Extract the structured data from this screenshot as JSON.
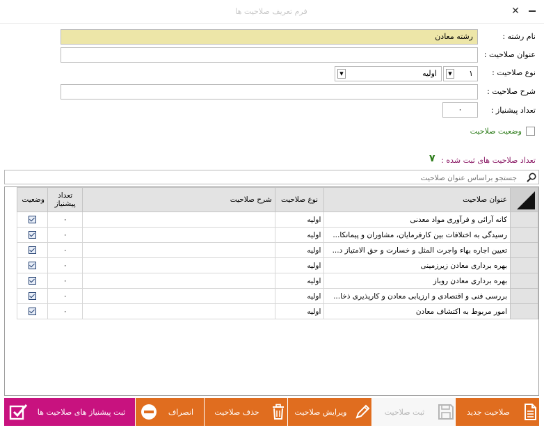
{
  "window": {
    "title": "فرم تعریف صلاحیت ها",
    "close_glyph": "✕",
    "minimize_label": "minimize"
  },
  "form": {
    "field_label": "نام رشته :",
    "field_value": "رشته معادن",
    "title_label": "عنوان صلاحیت :",
    "title_value": "",
    "type_label": "نوع صلاحیت :",
    "type_code": "۱",
    "type_value": "اولیه",
    "desc_label": "شرح صلاحیت :",
    "desc_value": "",
    "prereq_label": "تعداد پیشنیاز :",
    "prereq_value": "۰",
    "status_label": "وضعیت صلاحیت"
  },
  "count": {
    "label": "تعداد صلاحیت های ثبت شده :",
    "value": "۷"
  },
  "search": {
    "placeholder": "جستجو براساس عنوان صلاحیت"
  },
  "grid": {
    "columns": {
      "title": "عنوان صلاحیت",
      "type": "نوع صلاحیت",
      "desc": "شرح صلاحیت",
      "prereq": "تعداد پیشنیاز",
      "status": "وضعیت"
    },
    "rows": [
      {
        "title": "کانه آرائی و فرآوری مواد معدنی",
        "type": "اولیه",
        "desc": "",
        "prereq": "۰"
      },
      {
        "title": "رسیدگی به اختلافات بین کارفرمایان، مشاوران و پیمانکا...",
        "type": "اولیه",
        "desc": "",
        "prereq": "۰"
      },
      {
        "title": "تعیین اجاره بهاء واجرت المثل و خسارت و حق الامتیاز د...",
        "type": "اولیه",
        "desc": "",
        "prereq": "۰"
      },
      {
        "title": "بهره برداری معادن زیرزمینی",
        "type": "اولیه",
        "desc": "",
        "prereq": "۰"
      },
      {
        "title": "بهره برداری معادن روباز",
        "type": "اولیه",
        "desc": "",
        "prereq": "۰"
      },
      {
        "title": "بررسی فنی و اقتصادی و ارزیابی معادن و کارپذیری ذخا...",
        "type": "اولیه",
        "desc": "",
        "prereq": "۰"
      },
      {
        "title": "امور مربوط به اکتشاف معادن",
        "type": "اولیه",
        "desc": "",
        "prereq": "۰"
      }
    ]
  },
  "toolbar": {
    "new_label": "صلاحیت جدید",
    "save_label": "ثبت صلاحیت",
    "edit_label": "ویرایش صلاحیت",
    "delete_label": "حذف صلاحیت",
    "cancel_label": "انصراف",
    "submit_prereq_label": "ثبت پیشنیاز های صلاحیت ها"
  },
  "colors": {
    "orange": "#e06d1f",
    "disabled": "#f7f7f7",
    "magenta": "#c8127f",
    "highlight_field": "#ede6a8",
    "green_text": "#2e7d1b",
    "count_label": "#8b1a66"
  }
}
